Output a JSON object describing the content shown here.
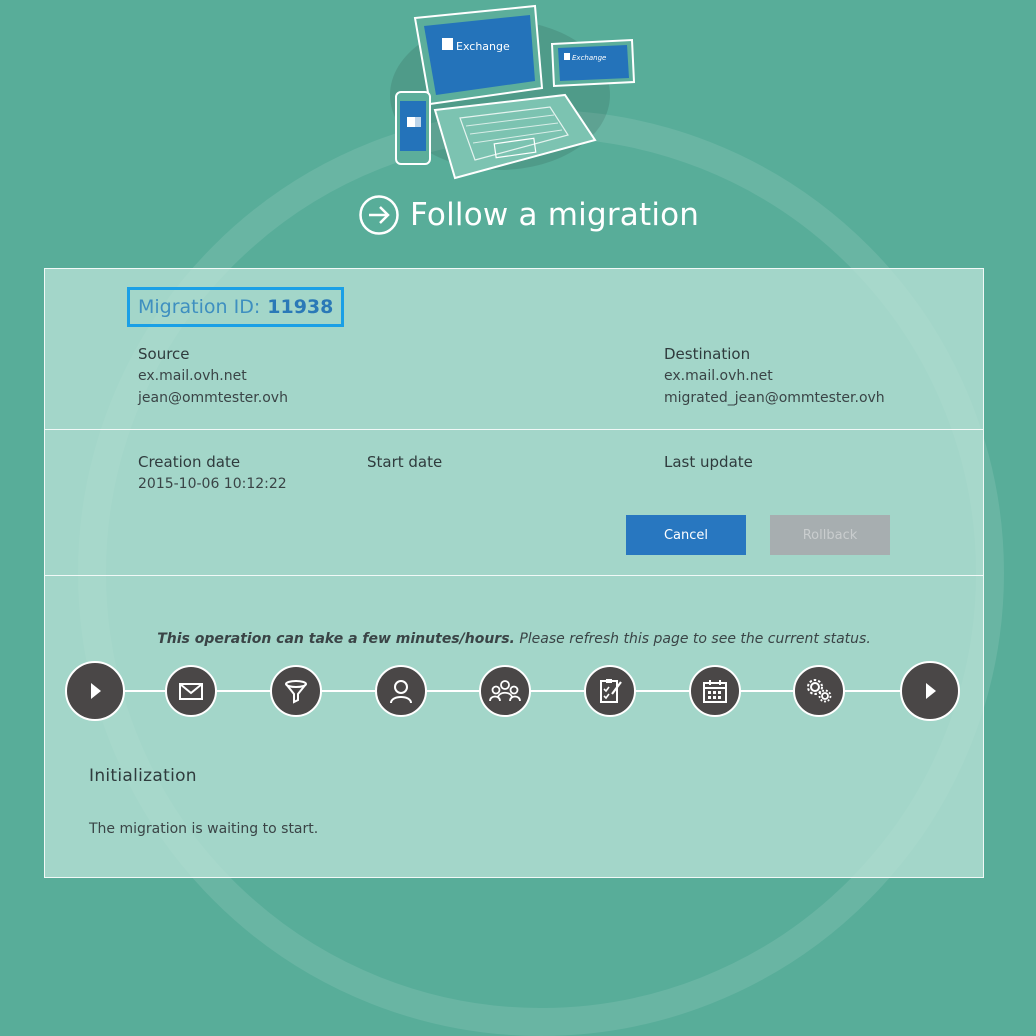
{
  "page": {
    "title": "Follow a migration",
    "hero_brand": "Exchange"
  },
  "migration": {
    "id_label": "Migration ID:",
    "id_value": "11938",
    "source_label": "Source",
    "source_server": "ex.mail.ovh.net",
    "source_account": "jean@ommtester.ovh",
    "destination_label": "Destination",
    "destination_server": "ex.mail.ovh.net",
    "destination_account": "migrated_jean@ommtester.ovh",
    "creation_label": "Creation date",
    "creation_value": "2015-10-06 10:12:22",
    "start_label": "Start date",
    "update_label": "Last update"
  },
  "actions": {
    "cancel_label": "Cancel",
    "rollback_label": "Rollback"
  },
  "progress": {
    "note_bold": "This operation can take a few minutes/hours.",
    "note_rest": " Please refresh this page to see the current status.",
    "steps": [
      {
        "icon": "play-icon"
      },
      {
        "icon": "envelope-icon"
      },
      {
        "icon": "filter-icon"
      },
      {
        "icon": "user-icon"
      },
      {
        "icon": "users-icon"
      },
      {
        "icon": "checklist-icon"
      },
      {
        "icon": "calendar-icon"
      },
      {
        "icon": "gears-icon"
      },
      {
        "icon": "play-icon"
      }
    ]
  },
  "status": {
    "title": "Initialization",
    "text": "The migration is waiting to start."
  },
  "colors": {
    "background": "#58ad99",
    "panel": "#b8e2d6",
    "primary_button": "#2877c0",
    "disabled_button": "#a7aeb0",
    "highlight_border": "#1aa0e6",
    "step_circle": "#4a4747"
  }
}
